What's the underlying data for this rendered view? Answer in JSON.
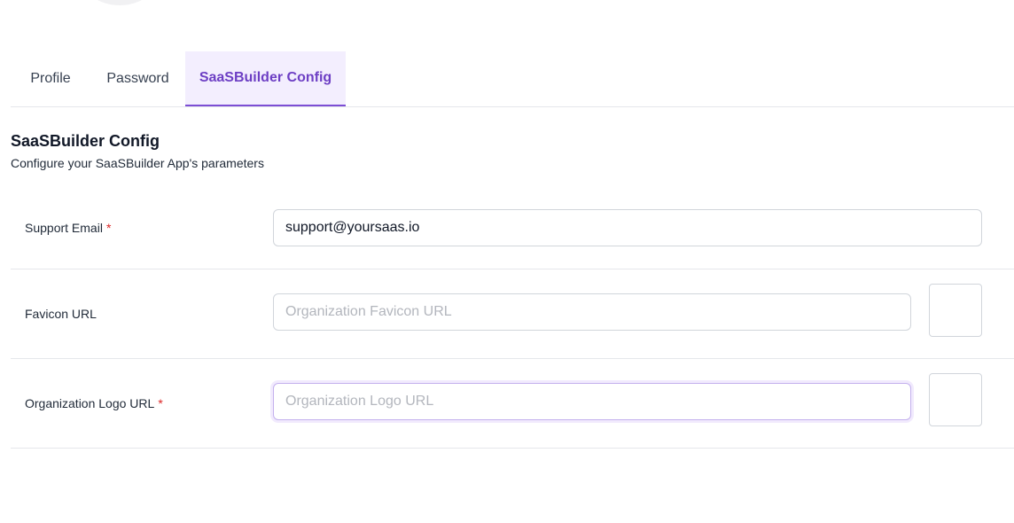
{
  "tabs": {
    "profile": "Profile",
    "password": "Password",
    "config": "SaaSBuilder Config"
  },
  "section": {
    "title": "SaaSBuilder Config",
    "description": "Configure your SaaSBuilder App's parameters"
  },
  "fields": {
    "support_email": {
      "label": "Support Email",
      "required_mark": "*",
      "value": "support@yoursaas.io"
    },
    "favicon_url": {
      "label": "Favicon URL",
      "placeholder": "Organization Favicon URL"
    },
    "logo_url": {
      "label": "Organization Logo URL",
      "required_mark": "*",
      "placeholder": "Organization Logo URL"
    }
  },
  "colors": {
    "accent": "#6d3fc4",
    "accent_bg": "#f3eefe",
    "required": "#dc2626"
  }
}
